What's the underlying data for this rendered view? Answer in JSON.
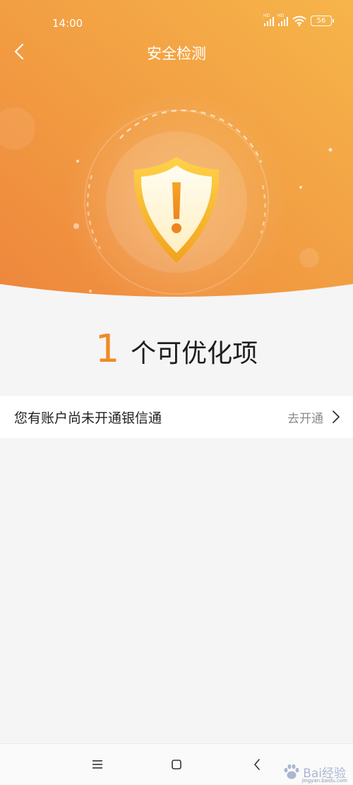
{
  "status_bar": {
    "time": "14:00",
    "signal_label_1": "HD",
    "signal_label_2": "HD",
    "battery": "56"
  },
  "nav": {
    "title": "安全检测",
    "back_icon": "chevron-left-icon"
  },
  "hero": {
    "shield_icon": "shield-warning-icon",
    "accent_color": "#f08a24",
    "gradient_colors": [
      "#ee8a3e",
      "#f5b349"
    ]
  },
  "summary": {
    "count": "1",
    "label": "个可优化项"
  },
  "items": [
    {
      "text": "您有账户尚未开通银信通",
      "action_label": "去开通",
      "action_icon": "chevron-right-icon"
    }
  ],
  "bottom_nav": {
    "menu_icon": "menu-icon",
    "home_icon": "home-square-icon",
    "back_icon": "back-triangle-icon"
  },
  "watermark": {
    "text": "Bai经验",
    "url": "jingyan.baidu.com"
  }
}
